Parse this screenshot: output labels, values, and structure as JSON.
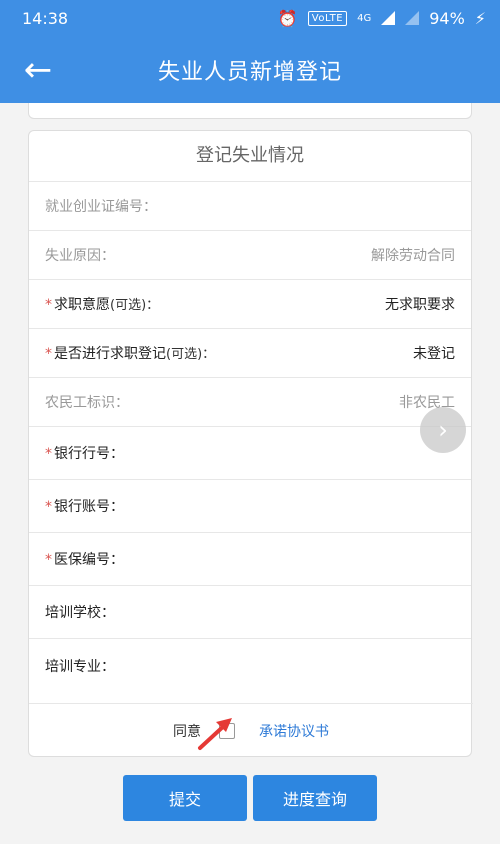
{
  "status": {
    "time": "14:38",
    "volte": "VoLTE",
    "network": "4G",
    "battery": "94%"
  },
  "appbar": {
    "title": "失业人员新增登记",
    "back_icon": "arrow-left-icon"
  },
  "card": {
    "title": "登记失业情况",
    "rows": [
      {
        "label": "就业创业证编号：",
        "value": "",
        "required": false,
        "optional": "",
        "muted": true
      },
      {
        "label": "失业原因：",
        "value": "解除劳动合同",
        "required": false,
        "optional": "",
        "muted": true
      },
      {
        "label": "求职意愿",
        "value": "无求职要求",
        "required": true,
        "optional": "(可选)：",
        "muted": false
      },
      {
        "label": "是否进行求职登记",
        "value": "未登记",
        "required": true,
        "optional": "(可选)：",
        "muted": false
      },
      {
        "label": "农民工标识：",
        "value": "非农民工",
        "required": false,
        "optional": "",
        "muted": true
      },
      {
        "label": "银行行号：",
        "value": "",
        "required": true,
        "optional": "",
        "muted": false
      },
      {
        "label": "银行账号：",
        "value": "",
        "required": true,
        "optional": "",
        "muted": false
      },
      {
        "label": "医保编号：",
        "value": "",
        "required": true,
        "optional": "",
        "muted": false
      },
      {
        "label": "培训学校：",
        "value": "",
        "required": false,
        "optional": "",
        "muted": false
      },
      {
        "label": "培训专业：",
        "value": "",
        "required": false,
        "optional": "",
        "muted": false
      }
    ],
    "agree": {
      "text": "同意",
      "link": "承诺协议书",
      "checked": false
    }
  },
  "buttons": {
    "submit": "提交",
    "progress": "进度查询"
  },
  "colors": {
    "primary": "#3f8fe4",
    "button": "#2d86e0",
    "required": "#d9534f",
    "link": "#2f7bd7"
  }
}
